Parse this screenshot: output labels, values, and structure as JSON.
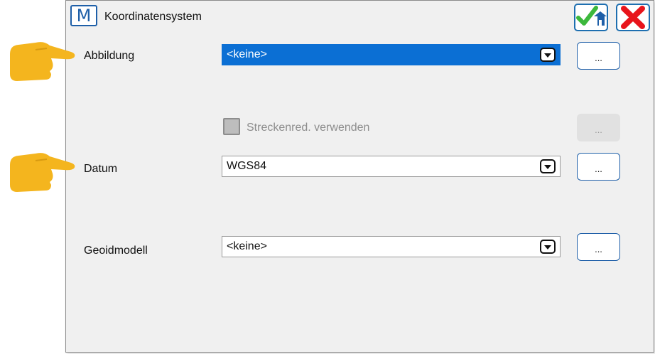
{
  "window": {
    "app_icon_letter": "M",
    "title": "Koordinatensystem"
  },
  "toolbar": {
    "ok_icon": "check-home-icon",
    "cancel_icon": "close-icon"
  },
  "fields": {
    "abbildung": {
      "label": "Abbildung",
      "value": "<keine>",
      "more": "..."
    },
    "streckenred": {
      "label": "Streckenred. verwenden",
      "checked": false,
      "enabled": false,
      "more": "..."
    },
    "datum": {
      "label": "Datum",
      "value": "WGS84",
      "more": "..."
    },
    "geoidmodell": {
      "label": "Geoidmodell",
      "value": "<keine>",
      "more": "..."
    }
  },
  "colors": {
    "accent": "#1e5fa8",
    "selection": "#0b6fd4",
    "check_green": "#3cb83c",
    "close_red": "#e8141b",
    "pointer_hand": "#f4b51e"
  }
}
